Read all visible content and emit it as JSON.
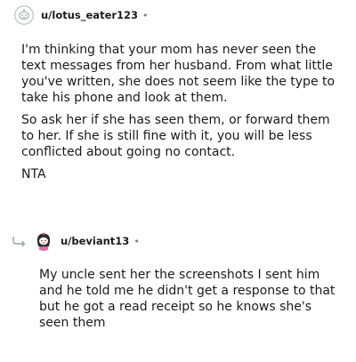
{
  "comments": [
    {
      "username": "u/lotus_eater123",
      "separator": "•",
      "avatar_icon": "default-user-avatar-icon",
      "paragraphs": [
        "I'm thinking that your mom has never seen the text messages from her husband. From what little you've written, she does not seem like the type to take his phone and look at them.",
        "So ask her if she has seen them, or forward them to her. If she is still fine with it, you will be less conflicted about going no contact.",
        "NTA"
      ]
    },
    {
      "username": "u/beviant13",
      "separator": "•",
      "avatar_icon": "snoo-avatar-icon",
      "reply_icon": "reply-arrow-icon",
      "paragraphs": [
        "My uncle sent her the screenshots I sent him and he told me he didn't get a response to that but he got a read receipt so he knows she's seen them"
      ]
    }
  ]
}
